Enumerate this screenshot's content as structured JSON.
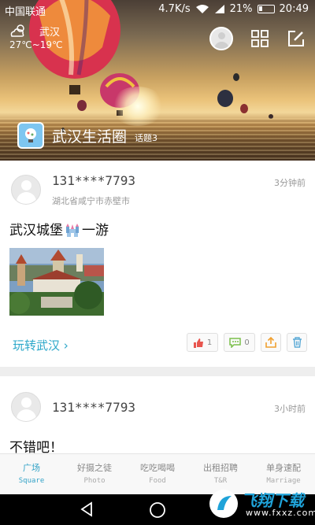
{
  "status_bar": {
    "carrier": "中国联通",
    "speed": "4.7K/s",
    "battery": "21%",
    "time": "20:49"
  },
  "weather": {
    "icon": "cloud-sun-icon",
    "city": "武汉",
    "temp": "27℃~19℃"
  },
  "header_icons": [
    "avatar",
    "grid-icon",
    "edit-icon"
  ],
  "group": {
    "name": "武汉生活圈",
    "topics": "话题3"
  },
  "posts": [
    {
      "user": "131****7793",
      "time": "3分钟前",
      "location": "湖北省咸宁市赤壁市",
      "title_before": "武汉城堡",
      "title_after": "一游",
      "tag": "玩转武汉 ›",
      "likes": "1",
      "comments": "0"
    },
    {
      "user": "131****7793",
      "time": "3小时前",
      "title": "不错吧！"
    }
  ],
  "bottom_nav": [
    {
      "cn": "广场",
      "en": "Square",
      "active": true
    },
    {
      "cn": "好摄之徒",
      "en": "Photo"
    },
    {
      "cn": "吃吃喝喝",
      "en": "Food"
    },
    {
      "cn": "出租招聘",
      "en": "T&R"
    },
    {
      "cn": "单身速配",
      "en": "Marriage"
    }
  ],
  "watermark": {
    "text": "飞翔下载",
    "sub": "www.fxxz.com"
  },
  "colors": {
    "accent": "#34a3c7",
    "link": "#2ba7c9",
    "like": "#e8554e",
    "comment": "#7bbf4a",
    "share": "#f0a030",
    "delete": "#5aa9d6"
  }
}
